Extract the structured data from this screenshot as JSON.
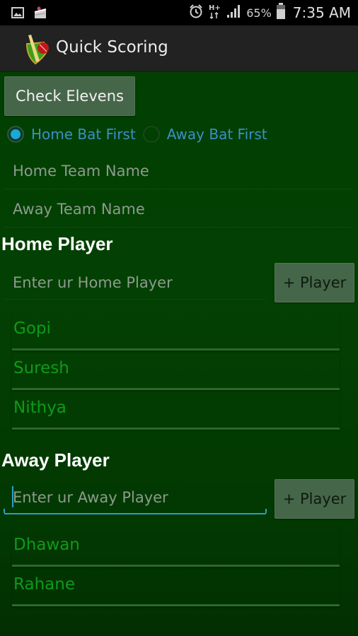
{
  "status_bar": {
    "left_icons": [
      "gallery-icon",
      "cake-icon"
    ],
    "right_icons": [
      "alarm-icon",
      "hplus-data-icon",
      "signal-icon",
      "battery-icon"
    ],
    "battery_percent": "65%",
    "time": "7:35 AM"
  },
  "action_bar": {
    "title": "Quick Scoring",
    "icon": "cricket-bat-ball-icon"
  },
  "main": {
    "check_elevens_label": "Check Elevens",
    "batting_options": [
      {
        "label": "Home Bat First",
        "selected": true
      },
      {
        "label": "Away Bat First",
        "selected": false
      }
    ],
    "home_team_placeholder": "Home Team Name",
    "away_team_placeholder": "Away Team Name",
    "home_section": {
      "title": "Home Player",
      "input_placeholder": "Enter ur Home Player",
      "add_label": "+ Player",
      "players": [
        "Gopi",
        "Suresh",
        "Nithya"
      ]
    },
    "away_section": {
      "title": "Away Player",
      "input_placeholder": "Enter ur Away Player",
      "add_label": "+ Player",
      "players": [
        "Dhawan",
        "Rahane"
      ]
    }
  },
  "colors": {
    "background": "#023f02",
    "action_bar": "#222222",
    "button": "#46664a",
    "radio_accent": "#1aa8d8",
    "radio_label": "#3b8fc7",
    "player_name": "#0f9a1a",
    "focus_accent": "#2aa0c8"
  }
}
